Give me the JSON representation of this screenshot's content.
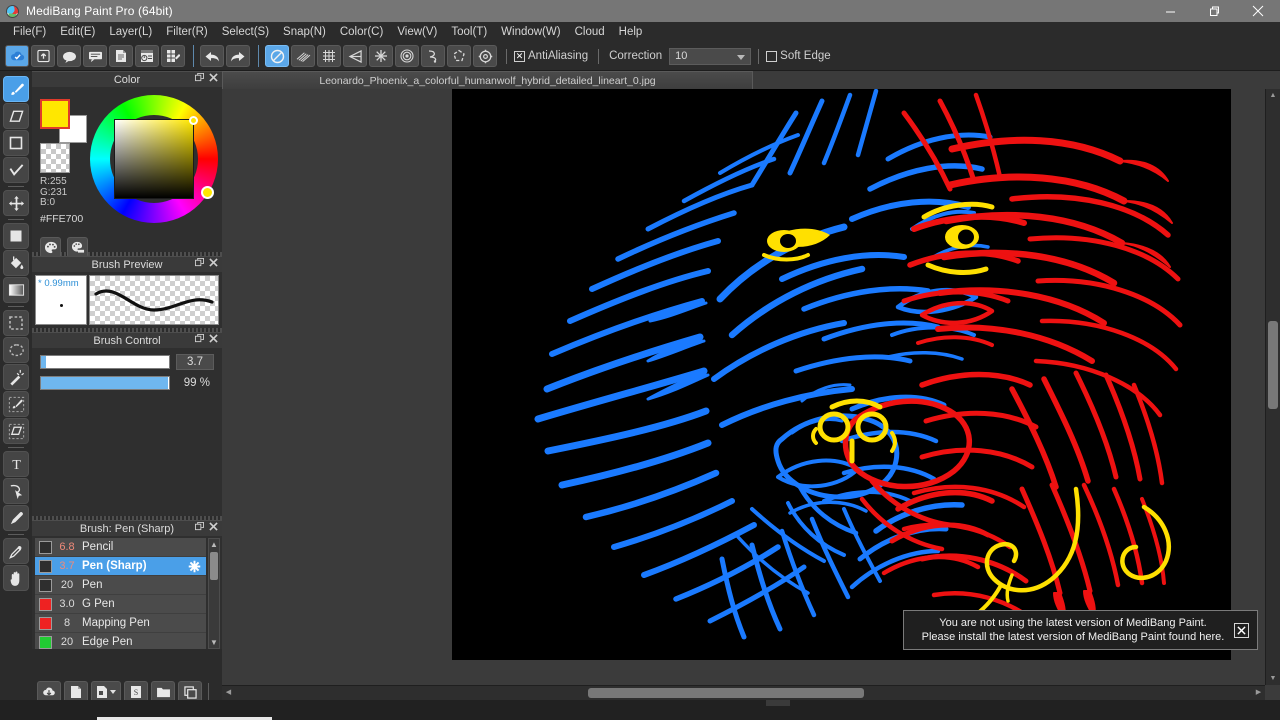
{
  "window": {
    "title": "MediBang Paint Pro (64bit)",
    "logo_icon": "medibang-logo-icon",
    "minimize_label": "–",
    "restore_label": "❐",
    "close_label": "✕"
  },
  "menubar": {
    "items": [
      {
        "label": "File(F)",
        "name": "menu-file"
      },
      {
        "label": "Edit(E)",
        "name": "menu-edit"
      },
      {
        "label": "Layer(L)",
        "name": "menu-layer"
      },
      {
        "label": "Filter(R)",
        "name": "menu-filter"
      },
      {
        "label": "Select(S)",
        "name": "menu-select"
      },
      {
        "label": "Snap(N)",
        "name": "menu-snap"
      },
      {
        "label": "Color(C)",
        "name": "menu-color"
      },
      {
        "label": "View(V)",
        "name": "menu-view"
      },
      {
        "label": "Tool(T)",
        "name": "menu-tool"
      },
      {
        "label": "Window(W)",
        "name": "menu-window"
      },
      {
        "label": "Cloud",
        "name": "menu-cloud"
      },
      {
        "label": "Help",
        "name": "menu-help"
      }
    ]
  },
  "toolbar": {
    "group1": [
      {
        "icon": "cloud-check-icon",
        "active": true
      },
      {
        "icon": "upload-icon",
        "active": false
      },
      {
        "icon": "comment-cloud-icon",
        "active": false
      },
      {
        "icon": "speech-balloon-icon",
        "active": false
      },
      {
        "icon": "page-icon",
        "active": false
      },
      {
        "icon": "page-timer-icon",
        "active": false
      },
      {
        "icon": "grid-edit-icon",
        "active": false
      }
    ],
    "group2": [
      {
        "icon": "undo-arrow-icon"
      },
      {
        "icon": "redo-arrow-icon"
      }
    ],
    "group3": [
      {
        "icon": "no-snap-icon",
        "active": true
      },
      {
        "icon": "parallel-lines-icon",
        "active": false
      },
      {
        "icon": "grid-snap-icon",
        "active": false
      },
      {
        "icon": "perspective-snap-icon",
        "active": false
      },
      {
        "icon": "radial-snap-icon",
        "active": false
      },
      {
        "icon": "concentric-circles-icon",
        "active": false
      },
      {
        "icon": "curve-snap-icon",
        "active": false
      },
      {
        "icon": "polygon-snap-icon",
        "active": false
      },
      {
        "icon": "gear-icon",
        "active": false
      }
    ],
    "antialiasing_label": "AntiAliasing",
    "antialiasing_checked": true,
    "antialiasing_mark": "✕",
    "correction_label": "Correction",
    "correction_value": "10",
    "soft_edge_label": "Soft Edge",
    "soft_edge_checked": false
  },
  "tools": {
    "items": [
      {
        "name": "tool-brush",
        "icon": "brush-icon",
        "active": true
      },
      {
        "name": "tool-eraser",
        "icon": "eraser-icon",
        "active": false
      },
      {
        "name": "tool-shape",
        "icon": "square-shape-icon",
        "active": false
      },
      {
        "name": "tool-brush-correction",
        "icon": "check-brush-icon",
        "active": false
      },
      {
        "sep": true
      },
      {
        "name": "tool-move",
        "icon": "move-arrows-icon",
        "active": false
      },
      {
        "sep": true
      },
      {
        "name": "tool-fill-rect",
        "icon": "filled-square-icon",
        "active": false
      },
      {
        "name": "tool-bucket",
        "icon": "paint-bucket-icon",
        "active": false
      },
      {
        "name": "tool-gradient",
        "icon": "gradient-icon",
        "active": false
      },
      {
        "sep": true
      },
      {
        "name": "tool-select-rect",
        "icon": "marquee-rect-icon",
        "active": false
      },
      {
        "name": "tool-select-lasso",
        "icon": "lasso-icon",
        "active": false
      },
      {
        "name": "tool-magic-wand",
        "icon": "magic-wand-icon",
        "active": false
      },
      {
        "name": "tool-select-brush",
        "icon": "select-brush-icon",
        "active": false
      },
      {
        "name": "tool-select-eraser",
        "icon": "select-eraser-icon",
        "active": false
      },
      {
        "sep": true
      },
      {
        "name": "tool-text",
        "icon": "text-t-icon",
        "active": false
      },
      {
        "name": "tool-operation",
        "icon": "cursor-operation-icon",
        "active": false
      },
      {
        "name": "tool-marker",
        "icon": "marker-pen-icon",
        "active": false
      },
      {
        "sep": true
      },
      {
        "name": "tool-eyedropper",
        "icon": "eyedropper-icon",
        "active": false
      },
      {
        "name": "tool-hand",
        "icon": "hand-icon",
        "active": false
      }
    ]
  },
  "color_panel": {
    "title": "Color",
    "float_icon": "float-window-icon",
    "close_icon": "close-icon",
    "r_label": "R:255",
    "g_label": "G:231",
    "b_label": "B:0",
    "hex": "#FFE700",
    "foreground_color": "#FFE700",
    "background_color": "#FFFFFF",
    "palette_icon": "palette-icon",
    "palette_swatch_icon": "palette-swatch-icon"
  },
  "brush_preview": {
    "title": "Brush Preview",
    "size_label": "* 0.99mm",
    "float_icon": "float-window-icon",
    "close_icon": "close-icon"
  },
  "brush_control": {
    "title": "Brush Control",
    "size_value": "3.7",
    "size_percent": 4,
    "opacity_value": "99 %",
    "opacity_percent": 99,
    "float_icon": "float-window-icon",
    "close_icon": "close-icon"
  },
  "brush_list": {
    "title": "Brush: Pen (Sharp)",
    "float_icon": "float-window-icon",
    "close_icon": "close-icon",
    "items": [
      {
        "color": "#2e2e2e",
        "num": "6.8",
        "num_color": "#f08a7a",
        "name": "Pencil",
        "selected": false
      },
      {
        "color": "#2e2e2e",
        "num": "3.7",
        "num_color": "#f08a7a",
        "name": "Pen (Sharp)",
        "selected": true,
        "gear": "gear-icon"
      },
      {
        "color": "#2e2e2e",
        "num": "20",
        "num_color": "#dcdcdc",
        "name": "Pen",
        "selected": false
      },
      {
        "color": "#ee2222",
        "num": "3.0",
        "num_color": "#dcdcdc",
        "name": "G Pen",
        "selected": false
      },
      {
        "color": "#ee2222",
        "num": "8",
        "num_color": "#dcdcdc",
        "name": "Mapping Pen",
        "selected": false
      },
      {
        "color": "#22cc33",
        "num": "20",
        "num_color": "#dcdcdc",
        "name": "Edge Pen",
        "selected": false
      }
    ],
    "scroll_up": "▲",
    "scroll_down": "▼",
    "footer_buttons": [
      {
        "icon": "cloud-download-icon",
        "name": "download-brush-button"
      },
      {
        "icon": "new-brush-icon",
        "name": "new-brush-button"
      },
      {
        "icon": "brush-dropdown-icon",
        "name": "brush-type-dropdown"
      },
      {
        "icon": "script-brush-icon",
        "name": "script-brush-button"
      },
      {
        "icon": "folder-icon",
        "name": "brush-folder-button"
      },
      {
        "icon": "duplicate-icon",
        "name": "duplicate-brush-button"
      }
    ]
  },
  "canvas": {
    "document_tab": "Leonardo_Phoenix_a_colorful_humanwolf_hybrid_detailed_lineart_0.jpg",
    "background_color": "#000000",
    "artwork": {
      "title": "colorful human-wolf hybrid detailed lineart",
      "left_color": "#1a7aff",
      "right_color": "#ee1111",
      "accent_color": "#ffe000"
    }
  },
  "notification": {
    "line1": "You are not using the latest version of MediBang Paint.",
    "line2": "Please install the latest version of MediBang Paint found here.",
    "close_label": "✕"
  },
  "scrollbars": {
    "v_up": "▲",
    "v_down": "▼",
    "h_left": "◀",
    "h_right": "▶"
  }
}
